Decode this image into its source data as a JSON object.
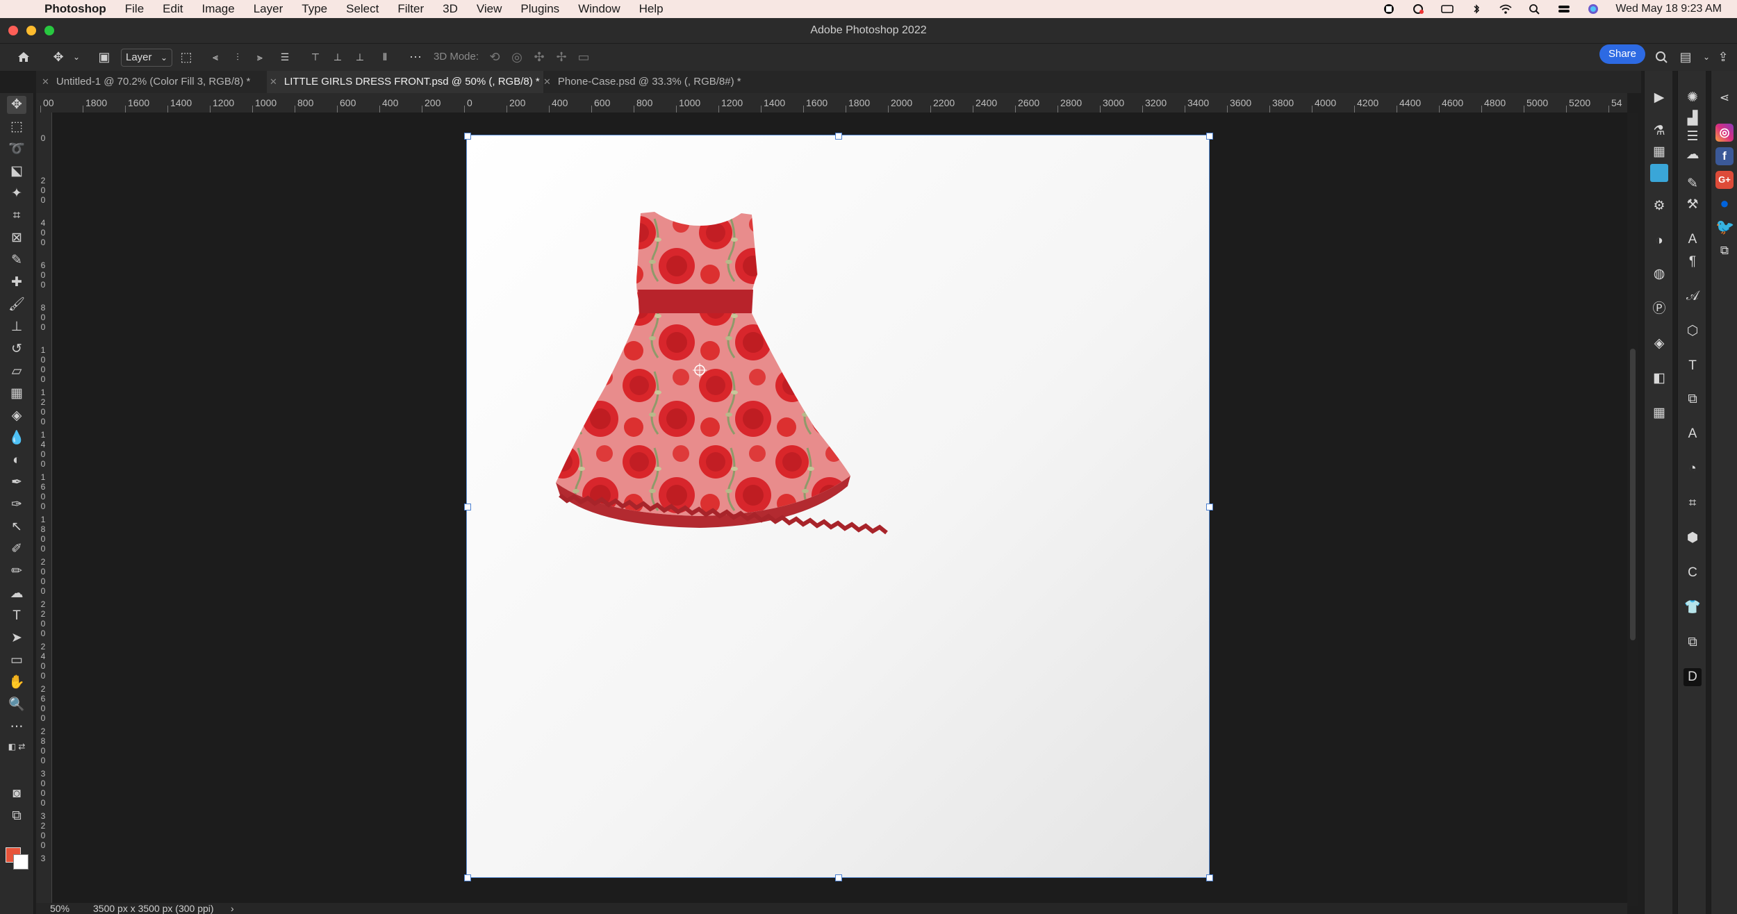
{
  "menubar": {
    "app_name": "Photoshop",
    "items": [
      "File",
      "Edit",
      "Image",
      "Layer",
      "Type",
      "Select",
      "Filter",
      "3D",
      "View",
      "Plugins",
      "Window",
      "Help"
    ],
    "clock": "Wed May 18  9:23 AM"
  },
  "window": {
    "title": "Adobe Photoshop 2022"
  },
  "options": {
    "auto_select": "Layer",
    "mode3d_label": "3D Mode:",
    "share_label": "Share"
  },
  "tabs": [
    {
      "label": "Untitled-1 @ 70.2% (Color Fill 3, RGB/8) *"
    },
    {
      "label": "LITTLE GIRLS DRESS FRONT.psd @ 50% (, RGB/8) *"
    },
    {
      "label": "Phone-Case.psd @ 33.3% (, RGB/8#) *"
    }
  ],
  "rulers": {
    "h_labels": [
      "00",
      "1800",
      "1600",
      "1400",
      "1200",
      "1000",
      "800",
      "600",
      "400",
      "200",
      "0",
      "200",
      "400",
      "600",
      "800",
      "1000",
      "1200",
      "1400",
      "1600",
      "1800",
      "2000",
      "2200",
      "2400",
      "2600",
      "2800",
      "3000",
      "3200",
      "3400",
      "3600",
      "3800",
      "4000",
      "4200",
      "4400",
      "4600",
      "4800",
      "5000",
      "5200",
      "54"
    ],
    "v_labels": [
      "0",
      "200",
      "400",
      "600",
      "800",
      "1000",
      "1200",
      "1400",
      "1600",
      "1800",
      "2000",
      "2200",
      "2400",
      "2600",
      "2800",
      "3000",
      "3200",
      "3"
    ]
  },
  "status": {
    "zoom": "50%",
    "doc_size": "3500 px x 3500 px (300 ppi)"
  },
  "colors": {
    "foreground": "#e8543a",
    "background": "#ffffff",
    "accent": "#2d6ae3"
  }
}
